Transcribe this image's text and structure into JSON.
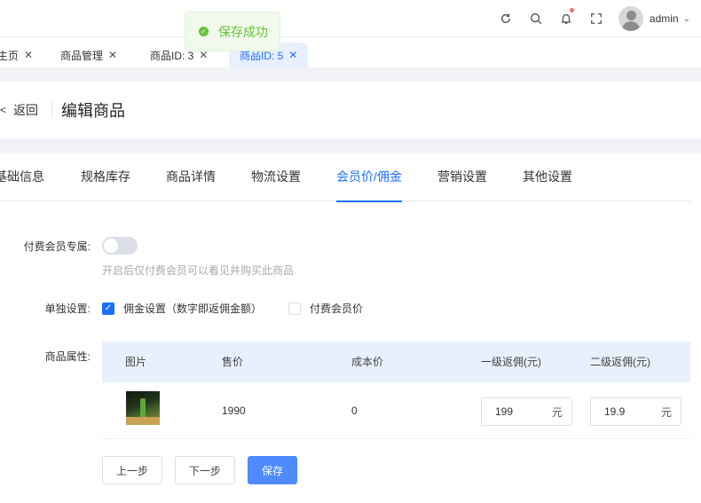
{
  "header": {
    "icons": [
      "refresh-icon",
      "search-icon",
      "bell-icon",
      "fullscreen-icon"
    ],
    "username": "admin",
    "notification_dot_color": "#f56c6c"
  },
  "tabs": [
    {
      "label": "主页",
      "active": false
    },
    {
      "label": "商品管理",
      "active": false
    },
    {
      "label": "商品ID: 3",
      "active": false
    },
    {
      "label": "商品ID: 5",
      "active": true
    }
  ],
  "toast": {
    "message": "保存成功",
    "color": "#67c23a"
  },
  "page": {
    "back_label": "返回",
    "title": "编辑商品"
  },
  "section_tabs": [
    {
      "label": "基础信息",
      "active": false
    },
    {
      "label": "规格库存",
      "active": false
    },
    {
      "label": "商品详情",
      "active": false
    },
    {
      "label": "物流设置",
      "active": false
    },
    {
      "label": "会员价/佣金",
      "active": true
    },
    {
      "label": "营销设置",
      "active": false
    },
    {
      "label": "其他设置",
      "active": false
    }
  ],
  "form": {
    "paid_member_label": "付费会员专属:",
    "paid_member_on": false,
    "paid_member_hint": "开启后仅付费会员可以看见并购买此商品",
    "separate_label": "单独设置:",
    "checkbox_commission": "佣金设置（数字即返佣金额）",
    "checkbox_commission_checked": true,
    "checkbox_member_price": "付费会员价",
    "checkbox_member_price_checked": false,
    "attr_label": "商品属性:"
  },
  "table": {
    "headers": [
      "图片",
      "售价",
      "成本价",
      "一级返佣(元)",
      "二级返佣(元)"
    ],
    "rows": [
      {
        "price": "1990",
        "cost": "0",
        "level1": "199",
        "level2": "19.9",
        "unit": "元"
      }
    ]
  },
  "buttons": {
    "prev": "上一步",
    "next": "下一步",
    "save": "保存"
  },
  "colors": {
    "accent": "#1e6fff",
    "primary_button": "#4d8bff",
    "table_header_bg": "#e8f0fd"
  }
}
